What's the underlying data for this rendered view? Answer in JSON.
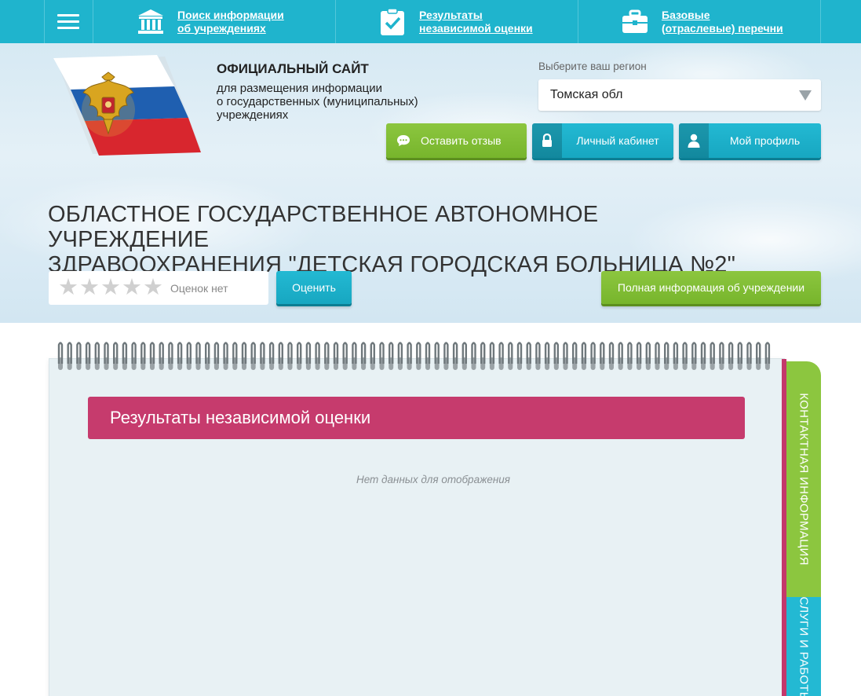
{
  "topnav": {
    "menu_icon": "hamburger-menu-icon",
    "links": [
      {
        "label": "Поиск информации\nоб учреждениях",
        "icon": "institution-building-icon"
      },
      {
        "label": "Результаты\nнезависимой оценки",
        "icon": "clipboard-check-icon"
      },
      {
        "label": "Базовые\n(отраслевые) перечни",
        "icon": "briefcase-icon"
      }
    ]
  },
  "header": {
    "site_title": "ОФИЦИАЛЬНЫЙ САЙТ",
    "site_subtitle": "для размещения информации\nо государственных (муниципальных)\nучреждениях",
    "region_label": "Выберите ваш регион",
    "region_value": "Томская обл",
    "buttons": {
      "feedback": "Оставить отзыв",
      "cabinet": "Личный кабинет",
      "profile": "Мой профиль"
    }
  },
  "institution": {
    "name": "ОБЛАСТНОЕ ГОСУДАРСТВЕННОЕ АВТОНОМНОЕ УЧРЕЖДЕНИЕ\nЗДРАВООХРАНЕНИЯ \"ДЕТСКАЯ ГОРОДСКАЯ БОЛЬНИЦА №2\"",
    "rating": {
      "stars_filled": 0,
      "stars_total": 5,
      "text": "Оценок нет"
    },
    "rate_button": "Оценить",
    "full_info_button": "Полная информация об учреждении"
  },
  "notebook": {
    "section_title": "Результаты независимой оценки",
    "empty_message": "Нет данных для отображения",
    "tabs": {
      "contact": "Контактная информация",
      "services": "Услуги и работы"
    }
  },
  "colors": {
    "nav": "#1fb4cd",
    "green": "#8cc63f",
    "teal": "#23b9d3",
    "magenta": "#c63b6d"
  }
}
